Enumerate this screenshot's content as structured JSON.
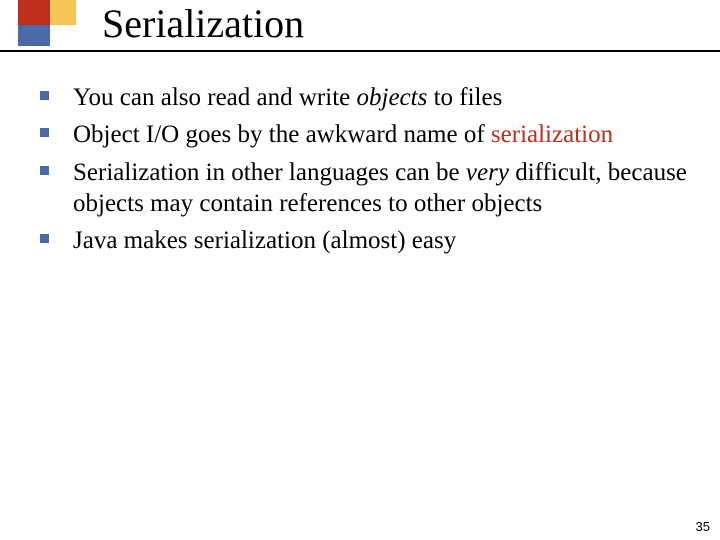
{
  "title": "Serialization",
  "bullets": [
    {
      "segments": [
        {
          "text": "You can also read and write "
        },
        {
          "text": "objects",
          "style": "i"
        },
        {
          "text": " to files"
        }
      ]
    },
    {
      "segments": [
        {
          "text": "Object I/O goes by the awkward name of "
        },
        {
          "text": "serialization",
          "style": "accent"
        }
      ]
    },
    {
      "segments": [
        {
          "text": "Serialization in other languages can be "
        },
        {
          "text": "very",
          "style": "i"
        },
        {
          "text": " difficult, because objects may contain references to other objects"
        }
      ]
    },
    {
      "segments": [
        {
          "text": "Java makes serialization (almost) easy"
        }
      ]
    }
  ],
  "page_number": "35",
  "colors": {
    "red": "#bd2f1a",
    "yellow": "#f6c555",
    "blue": "#4a6aa7"
  }
}
